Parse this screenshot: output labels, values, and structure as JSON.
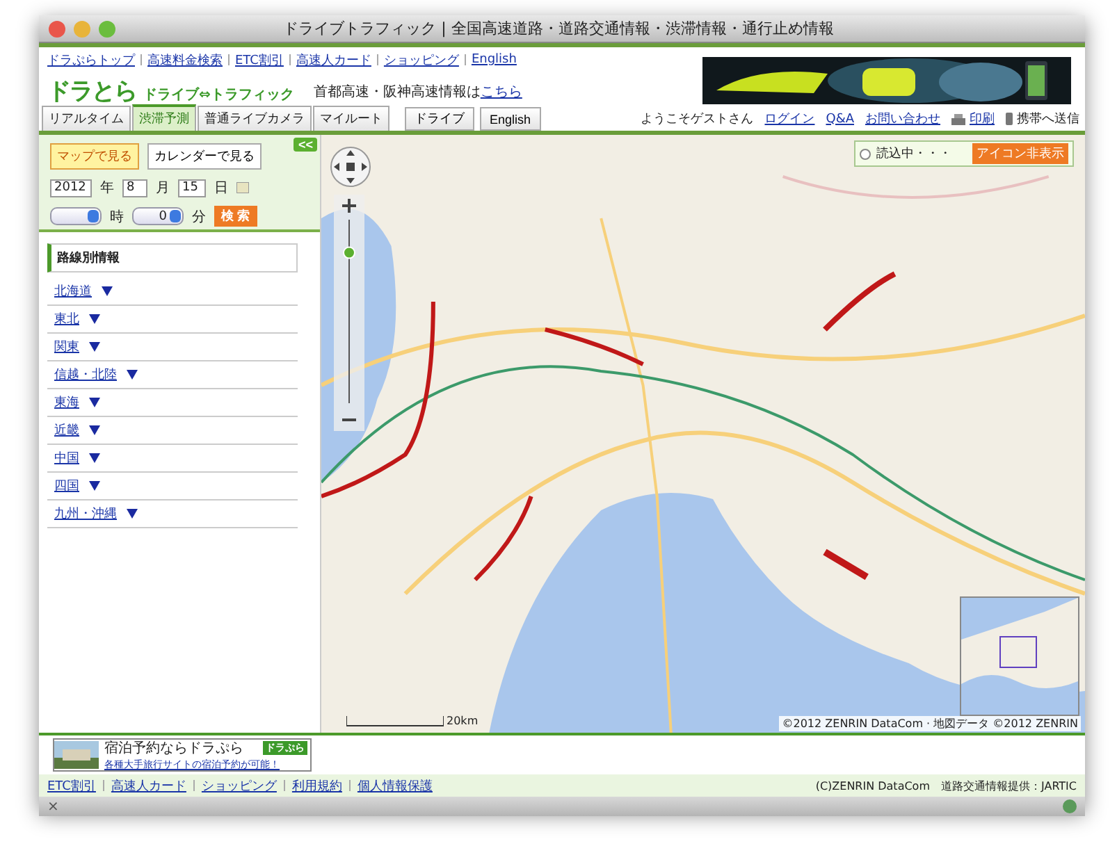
{
  "window": {
    "title": "ドライブトラフィック | 全国高速道路・道路交通情報・渋滞情報・通行止め情報"
  },
  "top_links": [
    "ドラぷらトップ",
    "高速料金検索",
    "ETC割引",
    "高速人カード",
    "ショッピング",
    "English"
  ],
  "logo": {
    "name": "ドラとら",
    "subtitle": "ドライブ⇔トラフィック"
  },
  "notice": {
    "text": "首都高速・阪神高速情報は",
    "link": "こちら"
  },
  "banner": {
    "kind": "picture"
  },
  "tabs": [
    {
      "label": "リアルタイム",
      "selected": false
    },
    {
      "label": "渋滞予測",
      "selected": true
    },
    {
      "label": "普通ライブカメラ",
      "selected": false
    },
    {
      "label": "マイルート",
      "selected": false
    }
  ],
  "mode_buttons": [
    "ドライブ",
    "English"
  ],
  "greeting": "ようこそゲストさん",
  "user_links": [
    {
      "label": "ログイン",
      "kind": "link"
    },
    {
      "label": "Q&A",
      "kind": "link"
    },
    {
      "label": "お問い合わせ",
      "kind": "link"
    },
    {
      "label": "印刷",
      "kind": "print"
    },
    {
      "label": "携帯へ送信",
      "kind": "mobile"
    }
  ],
  "panel": {
    "collapse": "<<",
    "view_buttons": [
      {
        "label": "マップで見る",
        "selected": true
      },
      {
        "label": "カレンダーで見る",
        "selected": false
      }
    ],
    "date": {
      "year": "2012",
      "year_unit": "年",
      "month": "8",
      "month_unit": "月",
      "day": "15",
      "day_unit": "日"
    },
    "time": {
      "hour_unit": "時",
      "minute": "0",
      "minute_unit": "分"
    },
    "search_button": "検 索"
  },
  "route_info": {
    "heading": "路線別情報",
    "regions": [
      "北海道",
      "東北",
      "関東",
      "信越・北陸",
      "東海",
      "近畿",
      "中国",
      "四国",
      "九州・沖縄"
    ]
  },
  "map": {
    "kind": "picture",
    "zoom": {
      "level": 0.82
    },
    "loading": "読込中・・・",
    "hide_icons_button": "アイコン非表示",
    "scale": "20km",
    "copyright": "©2012 ZENRIN DataCom · 地図データ ©2012 ZENRIN"
  },
  "footer_ad": {
    "title": "宿泊予約ならドラぷら",
    "logo": "ドラぷら",
    "text": "各種大手旅行サイトの宿泊予約が可能！"
  },
  "footer_links": [
    "ETC割引",
    "高速人カード",
    "ショッピング",
    "利用規約",
    "個人情報保護"
  ],
  "credits": "(C)ZENRIN DataCom　道路交通情報提供：JARTIC",
  "status_bar": {
    "close": "×"
  }
}
